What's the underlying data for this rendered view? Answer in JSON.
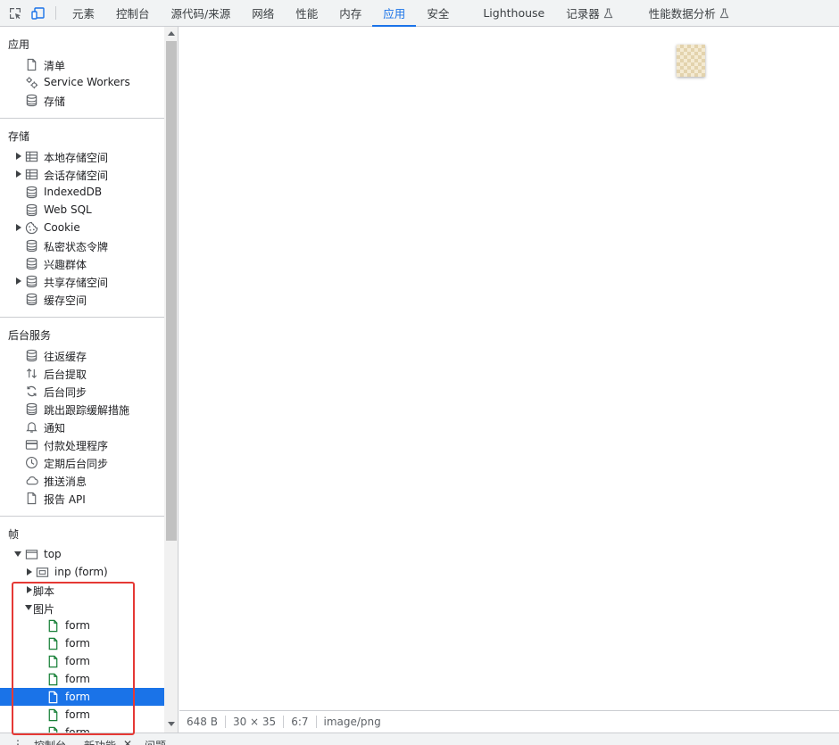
{
  "toolbar": {
    "tabs": [
      {
        "label": "元素"
      },
      {
        "label": "控制台"
      },
      {
        "label": "源代码/来源"
      },
      {
        "label": "网络"
      },
      {
        "label": "性能"
      },
      {
        "label": "内存"
      },
      {
        "label": "应用",
        "active": true
      },
      {
        "label": "安全"
      },
      {
        "label": "Lighthouse"
      },
      {
        "label": "记录器",
        "flask": true
      },
      {
        "label": "性能数据分析",
        "flask": true
      }
    ]
  },
  "sidebar": {
    "app": {
      "title": "应用",
      "items": [
        {
          "label": "清单",
          "icon": "document-icon"
        },
        {
          "label": "Service Workers",
          "icon": "gears-icon"
        },
        {
          "label": "存储",
          "icon": "database-icon"
        }
      ]
    },
    "storage": {
      "title": "存储",
      "items": [
        {
          "label": "本地存储空间",
          "icon": "table-icon",
          "expandable": true
        },
        {
          "label": "会话存储空间",
          "icon": "table-icon",
          "expandable": true
        },
        {
          "label": "IndexedDB",
          "icon": "database-icon"
        },
        {
          "label": "Web SQL",
          "icon": "database-icon"
        },
        {
          "label": "Cookie",
          "icon": "cookie-icon",
          "expandable": true
        },
        {
          "label": "私密状态令牌",
          "icon": "database-icon"
        },
        {
          "label": "兴趣群体",
          "icon": "database-icon"
        },
        {
          "label": "共享存储空间",
          "icon": "database-icon",
          "expandable": true
        },
        {
          "label": "缓存空间",
          "icon": "database-icon"
        }
      ]
    },
    "background": {
      "title": "后台服务",
      "items": [
        {
          "label": "往返缓存",
          "icon": "database-icon"
        },
        {
          "label": "后台提取",
          "icon": "arrows-updown-icon"
        },
        {
          "label": "后台同步",
          "icon": "sync-icon"
        },
        {
          "label": "跳出跟踪缓解措施",
          "icon": "database-icon"
        },
        {
          "label": "通知",
          "icon": "bell-icon"
        },
        {
          "label": "付款处理程序",
          "icon": "card-icon"
        },
        {
          "label": "定期后台同步",
          "icon": "clock-icon"
        },
        {
          "label": "推送消息",
          "icon": "cloud-icon"
        },
        {
          "label": "报告 API",
          "icon": "document-icon"
        }
      ]
    },
    "frames": {
      "title": "帧",
      "top": "top",
      "child": "inp (form)",
      "scripts": "脚本",
      "images": "图片",
      "image_items": [
        "form",
        "form",
        "form",
        "form",
        "form",
        "form",
        "form"
      ],
      "selected_index": 4
    }
  },
  "status": {
    "size": "648 B",
    "dimensions": "30 × 35",
    "ratio": "6:7",
    "mime": "image/png"
  },
  "drawer": {
    "tabs": [
      "控制台",
      "新功能",
      "问题"
    ]
  },
  "colors": {
    "accent": "#1a73e8",
    "highlight": "#e53935",
    "file_icon": "#188038"
  }
}
